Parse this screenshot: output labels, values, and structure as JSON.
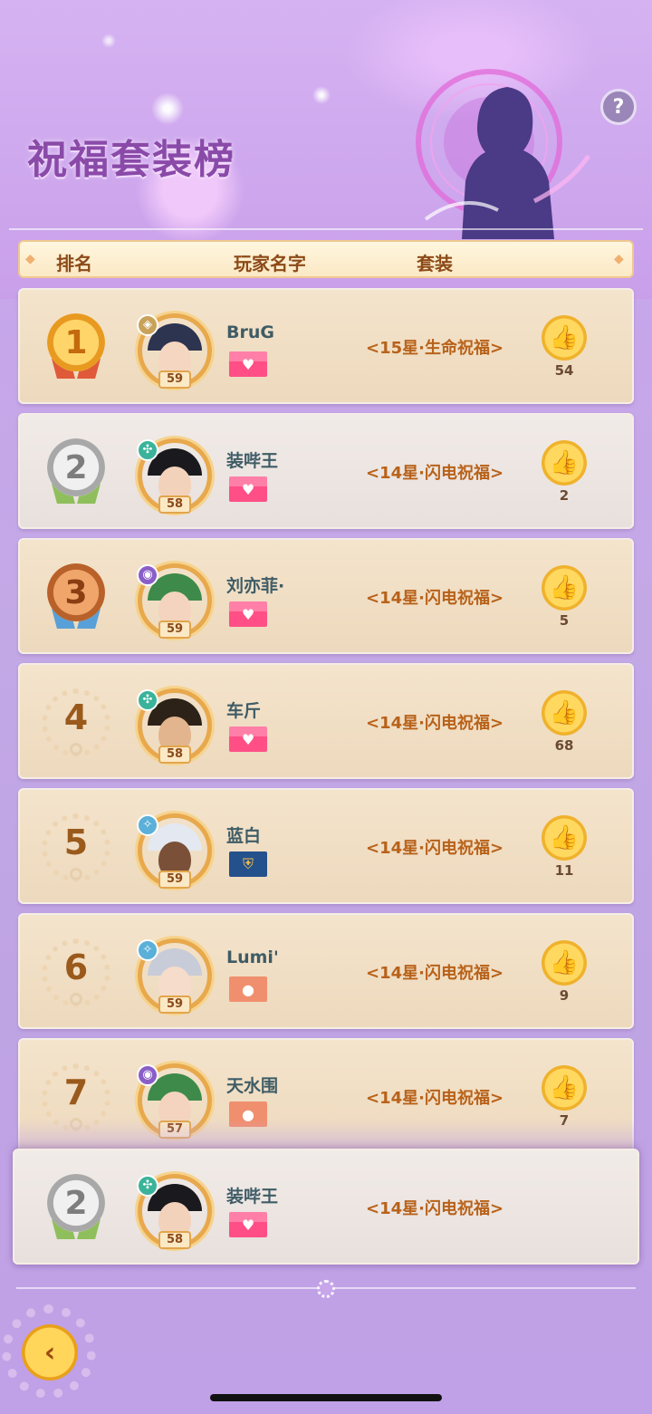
{
  "header": {
    "title": "祝福套装榜",
    "help_label": "?"
  },
  "columns": {
    "rank": "排名",
    "player": "玩家名字",
    "suit": "套装"
  },
  "rows": [
    {
      "rank": "1",
      "medal": "gold",
      "level": "59",
      "name": "BruG",
      "badge": "heart",
      "suit": "<15星·生命祝福>",
      "likes": "54",
      "element": "rock",
      "hair": "#2c3450",
      "skin": "#f5d6c0",
      "style": "tan"
    },
    {
      "rank": "2",
      "medal": "silver",
      "level": "58",
      "name": "装哔王",
      "badge": "heart",
      "suit": "<14星·闪电祝福>",
      "likes": "2",
      "element": "wind",
      "hair": "#1a1a1e",
      "skin": "#f3d2bc",
      "style": "grey"
    },
    {
      "rank": "3",
      "medal": "bronze",
      "level": "59",
      "name": "刘亦菲·",
      "badge": "heart",
      "suit": "<14星·闪电祝福>",
      "likes": "5",
      "element": "thunder",
      "hair": "#3e8a4a",
      "skin": "#f4d4be",
      "style": "tan"
    },
    {
      "rank": "4",
      "medal": "none",
      "level": "58",
      "name": "车斤",
      "badge": "heart",
      "suit": "<14星·闪电祝福>",
      "likes": "68",
      "element": "wind",
      "hair": "#2c2218",
      "skin": "#e2b58e",
      "style": "tan"
    },
    {
      "rank": "5",
      "medal": "none",
      "level": "59",
      "name": "蓝白",
      "badge": "shield",
      "suit": "<14星·闪电祝福>",
      "likes": "11",
      "element": "ice",
      "hair": "#e4e8f0",
      "skin": "#7a5038",
      "style": "tan"
    },
    {
      "rank": "6",
      "medal": "none",
      "level": "59",
      "name": "Lumi'",
      "badge": "bear",
      "suit": "<14星·闪电祝福>",
      "likes": "9",
      "element": "ice",
      "hair": "#c8ccd8",
      "skin": "#f6dccb",
      "style": "tan"
    },
    {
      "rank": "7",
      "medal": "none",
      "level": "57",
      "name": "天水围",
      "badge": "bear",
      "suit": "<14星·闪电祝福>",
      "likes": "7",
      "element": "thunder",
      "hair": "#3e8a4a",
      "skin": "#f4d4be",
      "style": "tan"
    }
  ],
  "my_rank": {
    "rank": "2",
    "medal": "silver",
    "level": "58",
    "name": "装哔王",
    "badge": "heart",
    "suit": "<14星·闪电祝福>",
    "element": "wind",
    "hair": "#1a1a1e",
    "skin": "#f3d2bc"
  },
  "icons": {
    "like": "thumbs-up-icon",
    "back": "back-arrow-icon",
    "help": "help-icon",
    "heart_badge": "heart-icon",
    "bear_badge": "bear-icon",
    "shield_badge": "shield-icon"
  },
  "colors": {
    "title": "#8a4aa8",
    "suit_text": "#b8621a",
    "row_tan": "#f4e4cc",
    "row_grey": "#f1ebe8",
    "like_gold": "#ffd860"
  }
}
